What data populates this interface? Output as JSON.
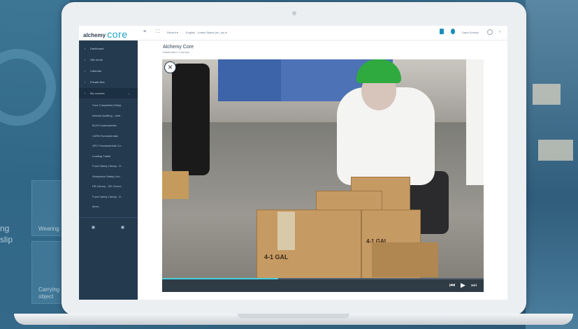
{
  "background": {
    "left_text_1": "ng",
    "left_text_2": "slip",
    "card_label_1": "Wearing",
    "card_label_2": "Carrying",
    "card_label_3": "object"
  },
  "topbar": {
    "logo_prefix": "alchemy",
    "logo_core": "core",
    "recent_label": "Recent ▾",
    "language_label": "English - United States (en_us) ▾",
    "user_name": "Dana Sornick",
    "collapse_icon": "‹"
  },
  "sidebar": {
    "items": [
      {
        "icon": "▪",
        "label": "Dashboard"
      },
      {
        "icon": "▪",
        "label": "Site home"
      },
      {
        "icon": "▪",
        "label": "Calendar"
      },
      {
        "icon": "▪",
        "label": "Private files"
      }
    ],
    "my_courses_label": "My courses",
    "my_courses_icon": "▪",
    "chevron": "⌄",
    "courses": [
      "Core Completed (Help)",
      "Internal Auditing - (Inte...",
      "BCA Fundamentals",
      "CAPA Fundamentals",
      "SPC Fundamentals Co...",
      "Loading Trailer",
      "Food Safety Library - E...",
      "Workplace Safety Libr...",
      "HR Library - DE Overvi...",
      "Food Safety Library - E...",
      "More..."
    ]
  },
  "main": {
    "title": "Alchemy Core",
    "breadcrumb": "Dashboard / Courses"
  },
  "video": {
    "close_label": "×",
    "skip_back_label": "⏮",
    "play_label": "▶",
    "skip_forward_label": "⏭",
    "progress": 0.36,
    "box_text_1": "4-1 GAL",
    "box_text_2": "4-1 GAL"
  },
  "colors": {
    "accent": "#1aa3c8",
    "sidebar": "#233a4f",
    "helmet": "#2faa3f",
    "progress": "#48d0e0"
  }
}
